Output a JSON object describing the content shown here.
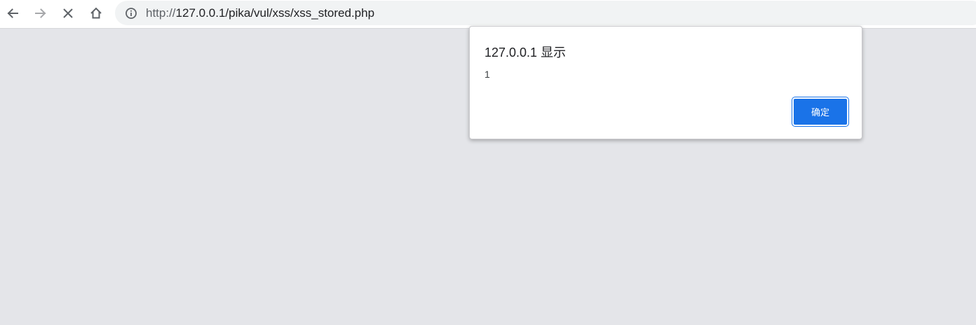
{
  "toolbar": {
    "icons": {
      "back": "arrow-left-icon",
      "forward": "arrow-right-icon",
      "stop": "close-icon",
      "home": "home-icon",
      "site_info": "info-circle-icon"
    },
    "forward_enabled": false
  },
  "address_bar": {
    "url_scheme": "http://",
    "url_host_path": "127.0.0.1/pika/vul/xss/xss_stored.php"
  },
  "alert_dialog": {
    "title": "127.0.0.1 显示",
    "message": "1",
    "ok_label": "确定"
  },
  "colors": {
    "page_background": "#e4e5e9",
    "accent": "#1a73e8",
    "omnibox_background": "#f1f3f4"
  }
}
